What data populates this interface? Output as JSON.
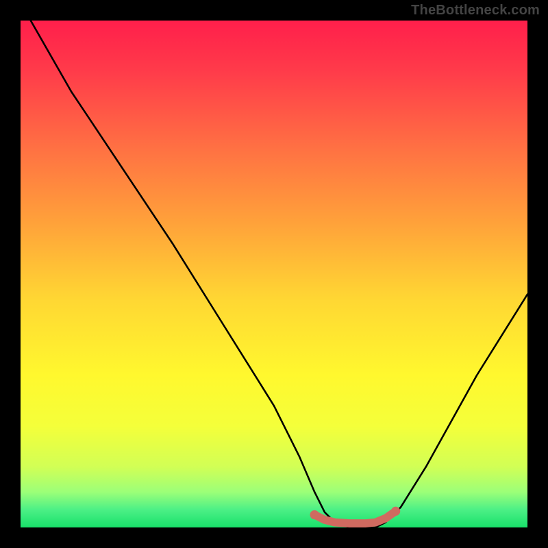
{
  "watermark": "TheBottleneck.com",
  "chart_data": {
    "type": "line",
    "title": "",
    "xlabel": "",
    "ylabel": "",
    "xlim": [
      0,
      100
    ],
    "ylim": [
      0,
      100
    ],
    "series": [
      {
        "name": "curve",
        "x": [
          2,
          10,
          20,
          30,
          40,
          50,
          55,
          58,
          60,
          62,
          65,
          68,
          70,
          72,
          75,
          80,
          85,
          90,
          95,
          100
        ],
        "y": [
          100,
          86,
          71,
          56,
          40,
          24,
          14,
          7,
          3,
          1,
          0,
          0,
          0,
          1,
          4,
          12,
          21,
          30,
          38,
          46
        ]
      },
      {
        "name": "highlight",
        "x": [
          58,
          60,
          62,
          65,
          68,
          70,
          72,
          74
        ],
        "y": [
          2.5,
          1.5,
          1,
          0.8,
          0.8,
          1,
          1.8,
          3.2
        ]
      }
    ],
    "gradient_stops": [
      {
        "pos": 0.0,
        "color": "#ff1f4b"
      },
      {
        "pos": 0.1,
        "color": "#ff3b4a"
      },
      {
        "pos": 0.25,
        "color": "#ff7043"
      },
      {
        "pos": 0.4,
        "color": "#ffa23a"
      },
      {
        "pos": 0.55,
        "color": "#ffd733"
      },
      {
        "pos": 0.7,
        "color": "#fff82e"
      },
      {
        "pos": 0.8,
        "color": "#f4ff3a"
      },
      {
        "pos": 0.88,
        "color": "#d2ff55"
      },
      {
        "pos": 0.93,
        "color": "#9cff78"
      },
      {
        "pos": 0.965,
        "color": "#4cf086"
      },
      {
        "pos": 1.0,
        "color": "#18e06a"
      }
    ],
    "highlight_color": "#d06a60",
    "curve_color": "#000000"
  }
}
